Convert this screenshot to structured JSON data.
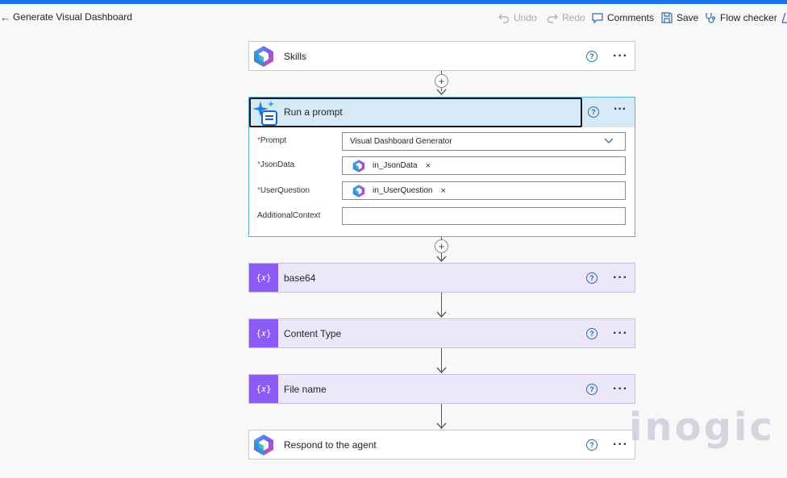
{
  "toolbar": {
    "title": "Generate Visual Dashboard",
    "undo": "Undo",
    "redo": "Redo",
    "comments": "Comments",
    "save": "Save",
    "flow_checker": "Flow checker"
  },
  "steps": {
    "skills": {
      "title": "Skills"
    },
    "run_prompt": {
      "title": "Run a prompt",
      "params": {
        "prompt_label": "Prompt",
        "prompt_value": "Visual Dashboard Generator",
        "json_label": "JsonData",
        "json_token": "in_JsonData",
        "question_label": "UserQuestion",
        "question_token": "in_UserQuestion",
        "context_label": "AdditionalContext",
        "context_value": ""
      }
    },
    "base64": {
      "title": "base64"
    },
    "content_type": {
      "title": "Content Type"
    },
    "file_name": {
      "title": "File name"
    },
    "respond": {
      "title": "Respond to the agent"
    }
  },
  "common": {
    "help_glyph": "?",
    "more_glyph": "···",
    "plus_glyph": "+",
    "remove_glyph": "×",
    "required_mark": "*",
    "variable_icon_glyph": "{𝑥}"
  },
  "watermark": "inogic",
  "colors": {
    "accent": "#1a73e8",
    "variable_header": "#8b5cf6",
    "variable_bg": "#ece6f9",
    "prompt_header_bg": "#d5e9f6",
    "help_icon": "#2b6cb0"
  }
}
